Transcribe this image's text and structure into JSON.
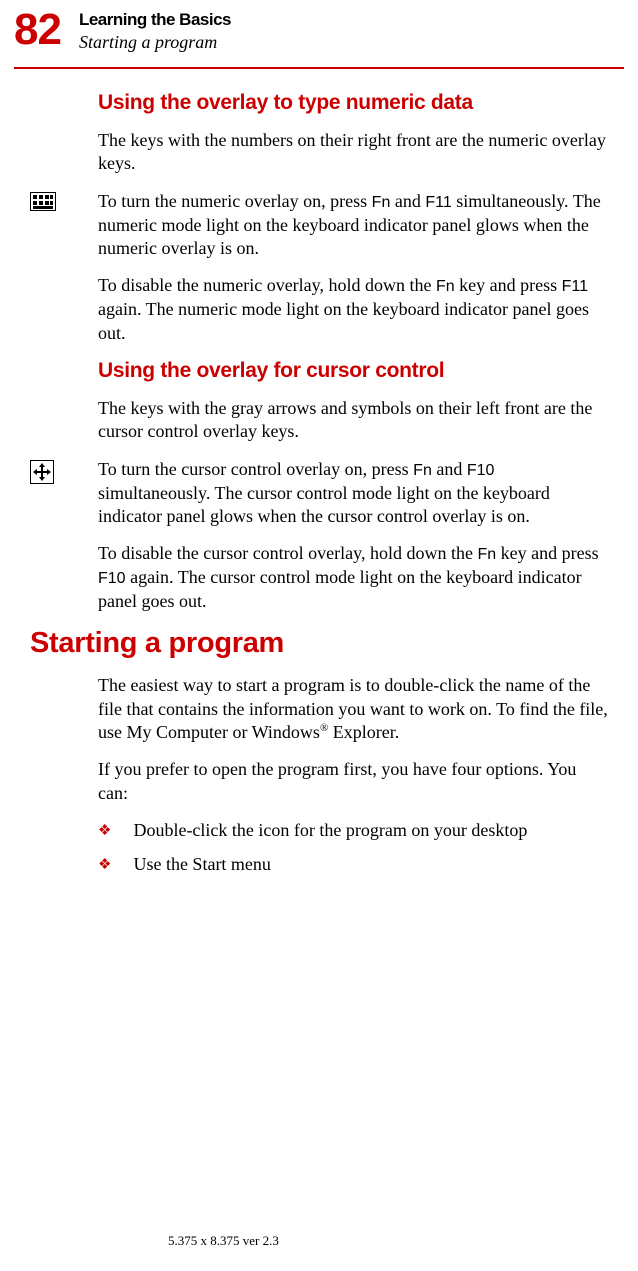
{
  "header": {
    "page_number": "82",
    "chapter": "Learning the Basics",
    "subtitle": "Starting a program"
  },
  "sections": {
    "numeric": {
      "heading": "Using the overlay to type numeric data",
      "p1": "The keys with the numbers on their right front are the numeric overlay keys.",
      "p2_pre": "To turn the numeric overlay on, press ",
      "p2_key1": "Fn",
      "p2_mid": " and ",
      "p2_key2": "F11",
      "p2_post": " simultaneously. The numeric mode light on the keyboard indicator panel glows when the numeric overlay is on.",
      "p3_pre": "To disable the numeric overlay, hold down the ",
      "p3_key1": "Fn",
      "p3_mid": " key and press ",
      "p3_key2": "F11",
      "p3_post": " again. The numeric mode light on the keyboard indicator panel goes out."
    },
    "cursor": {
      "heading": "Using the overlay for cursor control",
      "p1": "The keys with the gray arrows and symbols on their left front are the cursor control overlay keys.",
      "p2_pre": "To turn the cursor control overlay on, press ",
      "p2_key1": "Fn",
      "p2_mid": " and ",
      "p2_key2": "F10",
      "p2_post": " simultaneously. The cursor control mode light on the keyboard indicator panel glows when the cursor control overlay is on.",
      "p3_pre": "To disable the cursor control overlay, hold down the ",
      "p3_key1": "Fn",
      "p3_mid": " key and press ",
      "p3_key2": "F10",
      "p3_post": " again. The cursor control mode light on the keyboard indicator panel goes out."
    },
    "starting": {
      "heading": "Starting a program",
      "p1_pre": "The easiest way to start a program is to double-click the name of the file that contains the information you want to work on. To find the file, use My Computer or Windows",
      "p1_sup": "®",
      "p1_post": " Explorer.",
      "p2": "If you prefer to open the program first, you have four options. You can:",
      "bullets": [
        "Double-click the icon for the program on your desktop",
        "Use the Start menu"
      ]
    }
  },
  "footer": "5.375 x 8.375 ver 2.3"
}
